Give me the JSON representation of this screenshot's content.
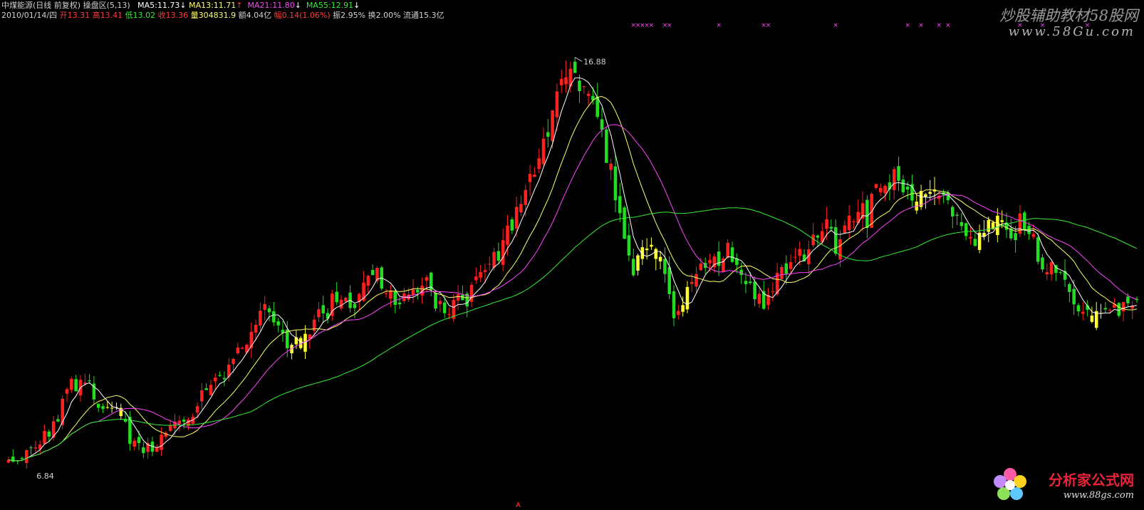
{
  "header": {
    "line1": [
      {
        "text": "中煤能源(日线 前复权) 操盘区(5,13)",
        "color": "#d0d0d0"
      },
      {
        "text": "   MA5:11.73",
        "color": "#ffffff"
      },
      {
        "text": "↓",
        "color": "#ffffff"
      },
      {
        "text": " MA13:11.71",
        "color": "#ffff66"
      },
      {
        "text": "↑",
        "color": "#ff3b3b"
      },
      {
        "text": "  MA21:11.80",
        "color": "#ff44ff"
      },
      {
        "text": "↓",
        "color": "#ffffff"
      },
      {
        "text": "  MA55:12.91",
        "color": "#33ee33"
      },
      {
        "text": "↓",
        "color": "#ffffff"
      }
    ],
    "line2": [
      {
        "text": "2010/01/14/四 ",
        "color": "#d0d0d0"
      },
      {
        "text": "开13.31 ",
        "color": "#ff3b3b"
      },
      {
        "text": "高13.41 ",
        "color": "#ff3b3b"
      },
      {
        "text": "低13.02 ",
        "color": "#33ee33"
      },
      {
        "text": "收13.36 ",
        "color": "#ff3b3b"
      },
      {
        "text": "量304831.9 ",
        "color": "#ffff66"
      },
      {
        "text": "额4.04亿 ",
        "color": "#d0d0d0"
      },
      {
        "text": "幅0.14(1.06%) ",
        "color": "#ff3b3b"
      },
      {
        "text": "振2.95% ",
        "color": "#d0d0d0"
      },
      {
        "text": "换2.00% ",
        "color": "#d0d0d0"
      },
      {
        "text": "流通15.3亿",
        "color": "#d0d0d0"
      }
    ]
  },
  "watermark": {
    "title": "炒股辅助教材58股网",
    "url": "www.58Gu.com",
    "logo_text": "分析家公式网",
    "logo_url": "www.88gs.com"
  },
  "colors": {
    "up": "#ff2020",
    "down": "#22dd22",
    "special": "#ffff33",
    "ma5": "#ffffff",
    "ma13": "#ffff66",
    "ma21": "#ff44ff",
    "ma55": "#33ee33",
    "marker": "#ff44ff",
    "label": "#d0d0d0"
  },
  "chart_data": {
    "type": "candlestick",
    "price_range": [
      6.0,
      17.5
    ],
    "high_label": "16.88",
    "low_label": "6.84",
    "bottom_mark": "A",
    "top_marker": "×",
    "marker_slots": [
      139,
      140,
      141,
      142,
      143,
      146,
      147,
      158,
      168,
      169,
      184,
      200,
      203,
      207,
      209,
      225,
      230,
      240
    ],
    "anchors": [
      [
        0,
        6.9
      ],
      [
        6,
        7.3
      ],
      [
        10,
        7.8
      ],
      [
        14,
        8.7
      ],
      [
        17,
        8.9
      ],
      [
        20,
        8.2
      ],
      [
        24,
        8.3
      ],
      [
        27,
        7.4
      ],
      [
        30,
        7.1
      ],
      [
        33,
        7.4
      ],
      [
        36,
        7.6
      ],
      [
        40,
        8.0
      ],
      [
        44,
        8.6
      ],
      [
        48,
        9.0
      ],
      [
        52,
        9.6
      ],
      [
        55,
        10.2
      ],
      [
        57,
        10.7
      ],
      [
        59,
        10.4
      ],
      [
        62,
        9.8
      ],
      [
        65,
        9.6
      ],
      [
        68,
        10.2
      ],
      [
        71,
        10.6
      ],
      [
        74,
        10.9
      ],
      [
        77,
        10.5
      ],
      [
        80,
        11.2
      ],
      [
        82,
        11.6
      ],
      [
        84,
        11.0
      ],
      [
        86,
        10.6
      ],
      [
        89,
        11.1
      ],
      [
        92,
        11.3
      ],
      [
        95,
        10.8
      ],
      [
        98,
        10.5
      ],
      [
        102,
        10.9
      ],
      [
        105,
        11.2
      ],
      [
        108,
        11.7
      ],
      [
        111,
        12.4
      ],
      [
        114,
        13.1
      ],
      [
        117,
        13.9
      ],
      [
        120,
        14.8
      ],
      [
        123,
        15.9
      ],
      [
        125,
        16.4
      ],
      [
        127,
        15.6
      ],
      [
        129,
        16.0
      ],
      [
        131,
        15.4
      ],
      [
        133,
        14.3
      ],
      [
        135,
        13.5
      ],
      [
        137,
        12.4
      ],
      [
        139,
        11.3
      ],
      [
        141,
        11.9
      ],
      [
        143,
        12.3
      ],
      [
        145,
        11.6
      ],
      [
        147,
        10.9
      ],
      [
        149,
        10.3
      ],
      [
        151,
        10.9
      ],
      [
        153,
        11.3
      ],
      [
        155,
        11.5
      ],
      [
        157,
        11.7
      ],
      [
        160,
        12.0
      ],
      [
        162,
        11.7
      ],
      [
        164,
        11.1
      ],
      [
        166,
        10.8
      ],
      [
        168,
        10.8
      ],
      [
        171,
        11.4
      ],
      [
        174,
        11.6
      ],
      [
        176,
        11.9
      ],
      [
        178,
        12.1
      ],
      [
        180,
        12.6
      ],
      [
        182,
        12.5
      ],
      [
        184,
        12.2
      ],
      [
        187,
        12.7
      ],
      [
        189,
        13.0
      ],
      [
        191,
        12.8
      ],
      [
        193,
        13.3
      ],
      [
        195,
        13.6
      ],
      [
        197,
        13.8
      ],
      [
        199,
        13.2
      ],
      [
        201,
        13.4
      ],
      [
        203,
        13.1
      ],
      [
        205,
        13.3
      ],
      [
        207,
        13.2
      ],
      [
        209,
        12.9
      ],
      [
        211,
        12.6
      ],
      [
        213,
        12.1
      ],
      [
        215,
        12.0
      ],
      [
        217,
        12.5
      ],
      [
        219,
        12.6
      ],
      [
        221,
        12.6
      ],
      [
        223,
        12.4
      ],
      [
        225,
        12.6
      ],
      [
        227,
        12.5
      ],
      [
        229,
        11.9
      ],
      [
        231,
        11.7
      ],
      [
        233,
        11.5
      ],
      [
        235,
        11.1
      ],
      [
        237,
        10.6
      ],
      [
        239,
        10.6
      ],
      [
        241,
        10.4
      ],
      [
        243,
        10.3
      ],
      [
        245,
        10.5
      ],
      [
        247,
        10.6
      ],
      [
        249,
        10.6
      ],
      [
        251,
        10.7
      ]
    ],
    "special_ranges": [
      [
        22,
        25
      ],
      [
        63,
        66
      ],
      [
        140,
        145
      ],
      [
        150,
        151
      ],
      [
        202,
        206
      ],
      [
        216,
        221
      ],
      [
        241,
        243
      ]
    ],
    "count": 252,
    "ma_periods": {
      "ma5": 5,
      "ma13": 13,
      "ma21": 21,
      "ma55": 55
    }
  }
}
